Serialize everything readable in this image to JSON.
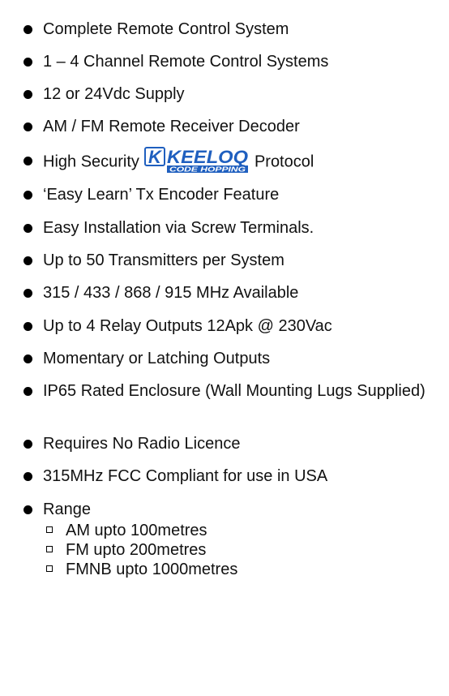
{
  "features": [
    {
      "text": "Complete Remote Control System"
    },
    {
      "text": "1 – 4 Channel Remote Control Systems"
    },
    {
      "text": "12 or 24Vdc Supply"
    },
    {
      "text": "AM / FM  Remote Receiver Decoder"
    },
    {
      "before": "High Security",
      "logo_main": "KEELOQ",
      "logo_sub": "CODE HOPPING",
      "after": "Protocol"
    },
    {
      "text": "‘Easy Learn’ Tx Encoder Feature"
    },
    {
      "text": "Easy Installation via Screw Terminals."
    },
    {
      "text": "Up to 50 Transmitters per System"
    },
    {
      "text": "315 / 433 / 868 / 915 MHz Available"
    },
    {
      "text": "Up to 4 Relay Outputs 12Apk @ 230Vac"
    },
    {
      "text": "Momentary or Latching Outputs"
    },
    {
      "text": "IP65 Rated Enclosure (Wall Mounting Lugs Supplied)"
    },
    {
      "text": "Requires No Radio Licence"
    },
    {
      "text": "315MHz FCC Compliant for use in USA"
    },
    {
      "text": "Range"
    }
  ],
  "range_items": [
    "AM upto 100metres",
    "FM upto 200metres",
    "FMNB upto 1000metres"
  ],
  "colors": {
    "text": "#111111",
    "logo_blue": "#1f5fbf"
  }
}
